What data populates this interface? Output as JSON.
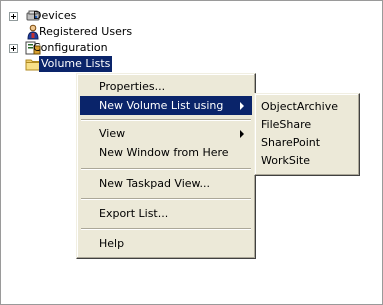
{
  "tree": {
    "items": [
      {
        "label": "Devices",
        "icon": "devices-icon",
        "expandable": true
      },
      {
        "label": "Registered Users",
        "icon": "registered-users-icon",
        "expandable": false
      },
      {
        "label": "Configuration",
        "icon": "configuration-icon",
        "expandable": true
      },
      {
        "label": "Volume Lists",
        "icon": "folder-icon",
        "expandable": false,
        "selected": true
      }
    ]
  },
  "context_menu": {
    "items": [
      {
        "label": "Properties..."
      },
      {
        "label": "New Volume List using",
        "has_submenu": true,
        "highlighted": true
      },
      {
        "label": "View",
        "has_submenu": true
      },
      {
        "label": "New Window from Here"
      },
      {
        "label": "New Taskpad View..."
      },
      {
        "label": "Export List..."
      },
      {
        "label": "Help"
      }
    ]
  },
  "submenu": {
    "items": [
      {
        "label": "ObjectArchive"
      },
      {
        "label": "FileShare"
      },
      {
        "label": "SharePoint"
      },
      {
        "label": "WorkSite"
      }
    ]
  },
  "colors": {
    "highlight": "#0a246a",
    "menu_background": "#ece9d8"
  }
}
